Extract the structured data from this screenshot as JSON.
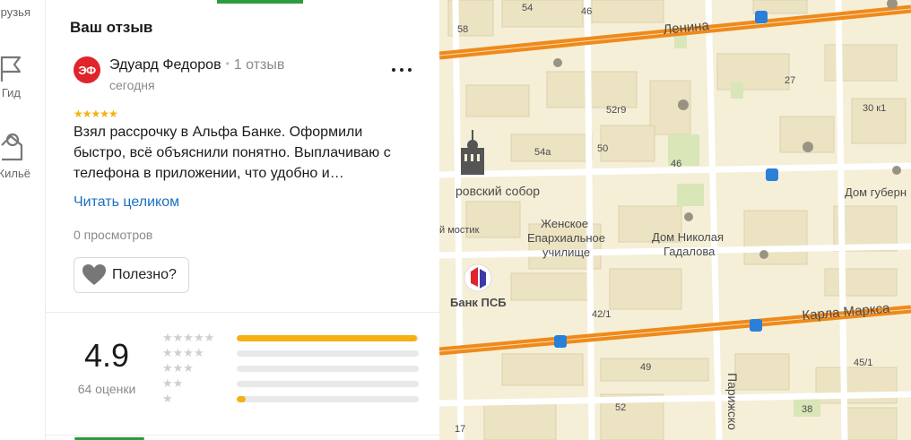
{
  "rail": {
    "items": [
      {
        "label": "рузья",
        "icon": "friends-icon"
      },
      {
        "label": "Гид",
        "icon": "flag-icon"
      },
      {
        "label": "Жильё",
        "icon": "housing-icon"
      }
    ]
  },
  "review": {
    "section_title": "Ваш отзыв",
    "avatar_initials": "ЭФ",
    "avatar_color": "#e0242c",
    "author_name": "Эдуард Федоров",
    "separator": "•",
    "author_review_count": "1 отзыв",
    "date": "сегодня",
    "rating": 5,
    "stars": "★★★★★",
    "text": "Взял рассрочку в Альфа Банке. Оформили быстро, всё объяснили понятно. Выплачиваю с телефона в приложении, что удобно и…",
    "read_more_label": "Читать целиком",
    "views": "0 просмотров",
    "helpful_label": "Полезно?",
    "more_icon": "more-dots-icon",
    "helpful_icon": "heart-icon"
  },
  "rating_summary": {
    "value": "4.9",
    "count_label": "64 оценки",
    "distribution": [
      {
        "stars": "★★★★★",
        "fraction": 0.99
      },
      {
        "stars": "★★★★",
        "fraction": 0.0
      },
      {
        "stars": "★★★",
        "fraction": 0.0
      },
      {
        "stars": "★★",
        "fraction": 0.0
      },
      {
        "stars": "★",
        "fraction": 0.05
      }
    ],
    "bar_color": "#f5b012"
  },
  "map": {
    "streets": [
      "Ленина",
      "Карла Маркса",
      "Парижско"
    ],
    "places": [
      "ровский собор",
      "Женское",
      "Епархиальное",
      "училище",
      "Дом Николая",
      "Гадалова",
      "Банк ПСБ",
      "Дом губерн",
      "й мостик"
    ],
    "house_numbers": [
      "54",
      "46",
      "58",
      "27",
      "52г9",
      "30 к1",
      "54а",
      "50",
      "46",
      "42/1",
      "49",
      "45/1",
      "52",
      "38",
      "17"
    ],
    "road_color": "#ef8a1a"
  }
}
